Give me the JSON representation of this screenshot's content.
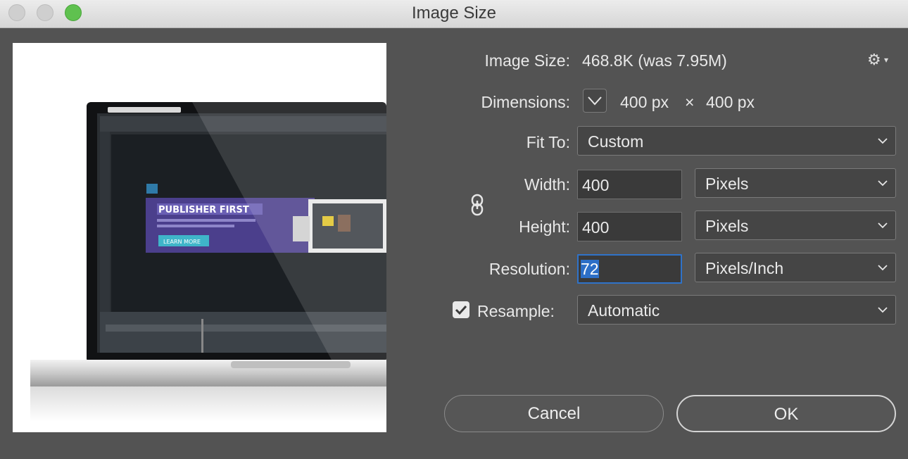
{
  "window": {
    "title": "Image Size"
  },
  "preview": {
    "banner_heading": "PUBLISHER FIRST",
    "banner_button": "LEARN MORE"
  },
  "info": {
    "image_size_label": "Image Size:",
    "image_size_value": "468.8K (was 7.95M)",
    "settings_icon": "gear-icon",
    "dimensions_label": "Dimensions:",
    "dimensions_width": "400 px",
    "dimensions_separator": "×",
    "dimensions_height": "400 px"
  },
  "form": {
    "fit_to_label": "Fit To:",
    "fit_to_value": "Custom",
    "width_label": "Width:",
    "width_value": "400",
    "width_unit": "Pixels",
    "height_label": "Height:",
    "height_value": "400",
    "height_unit": "Pixels",
    "resolution_label": "Resolution:",
    "resolution_value": "72",
    "resolution_unit": "Pixels/Inch",
    "resample_label": "Resample:",
    "resample_checked": true,
    "resample_value": "Automatic",
    "constrain_icon": "link-icon"
  },
  "buttons": {
    "cancel": "Cancel",
    "ok": "OK"
  },
  "colors": {
    "dialog_bg": "#535353",
    "selection": "#2d6fc7",
    "traffic_green": "#5fc14f"
  }
}
